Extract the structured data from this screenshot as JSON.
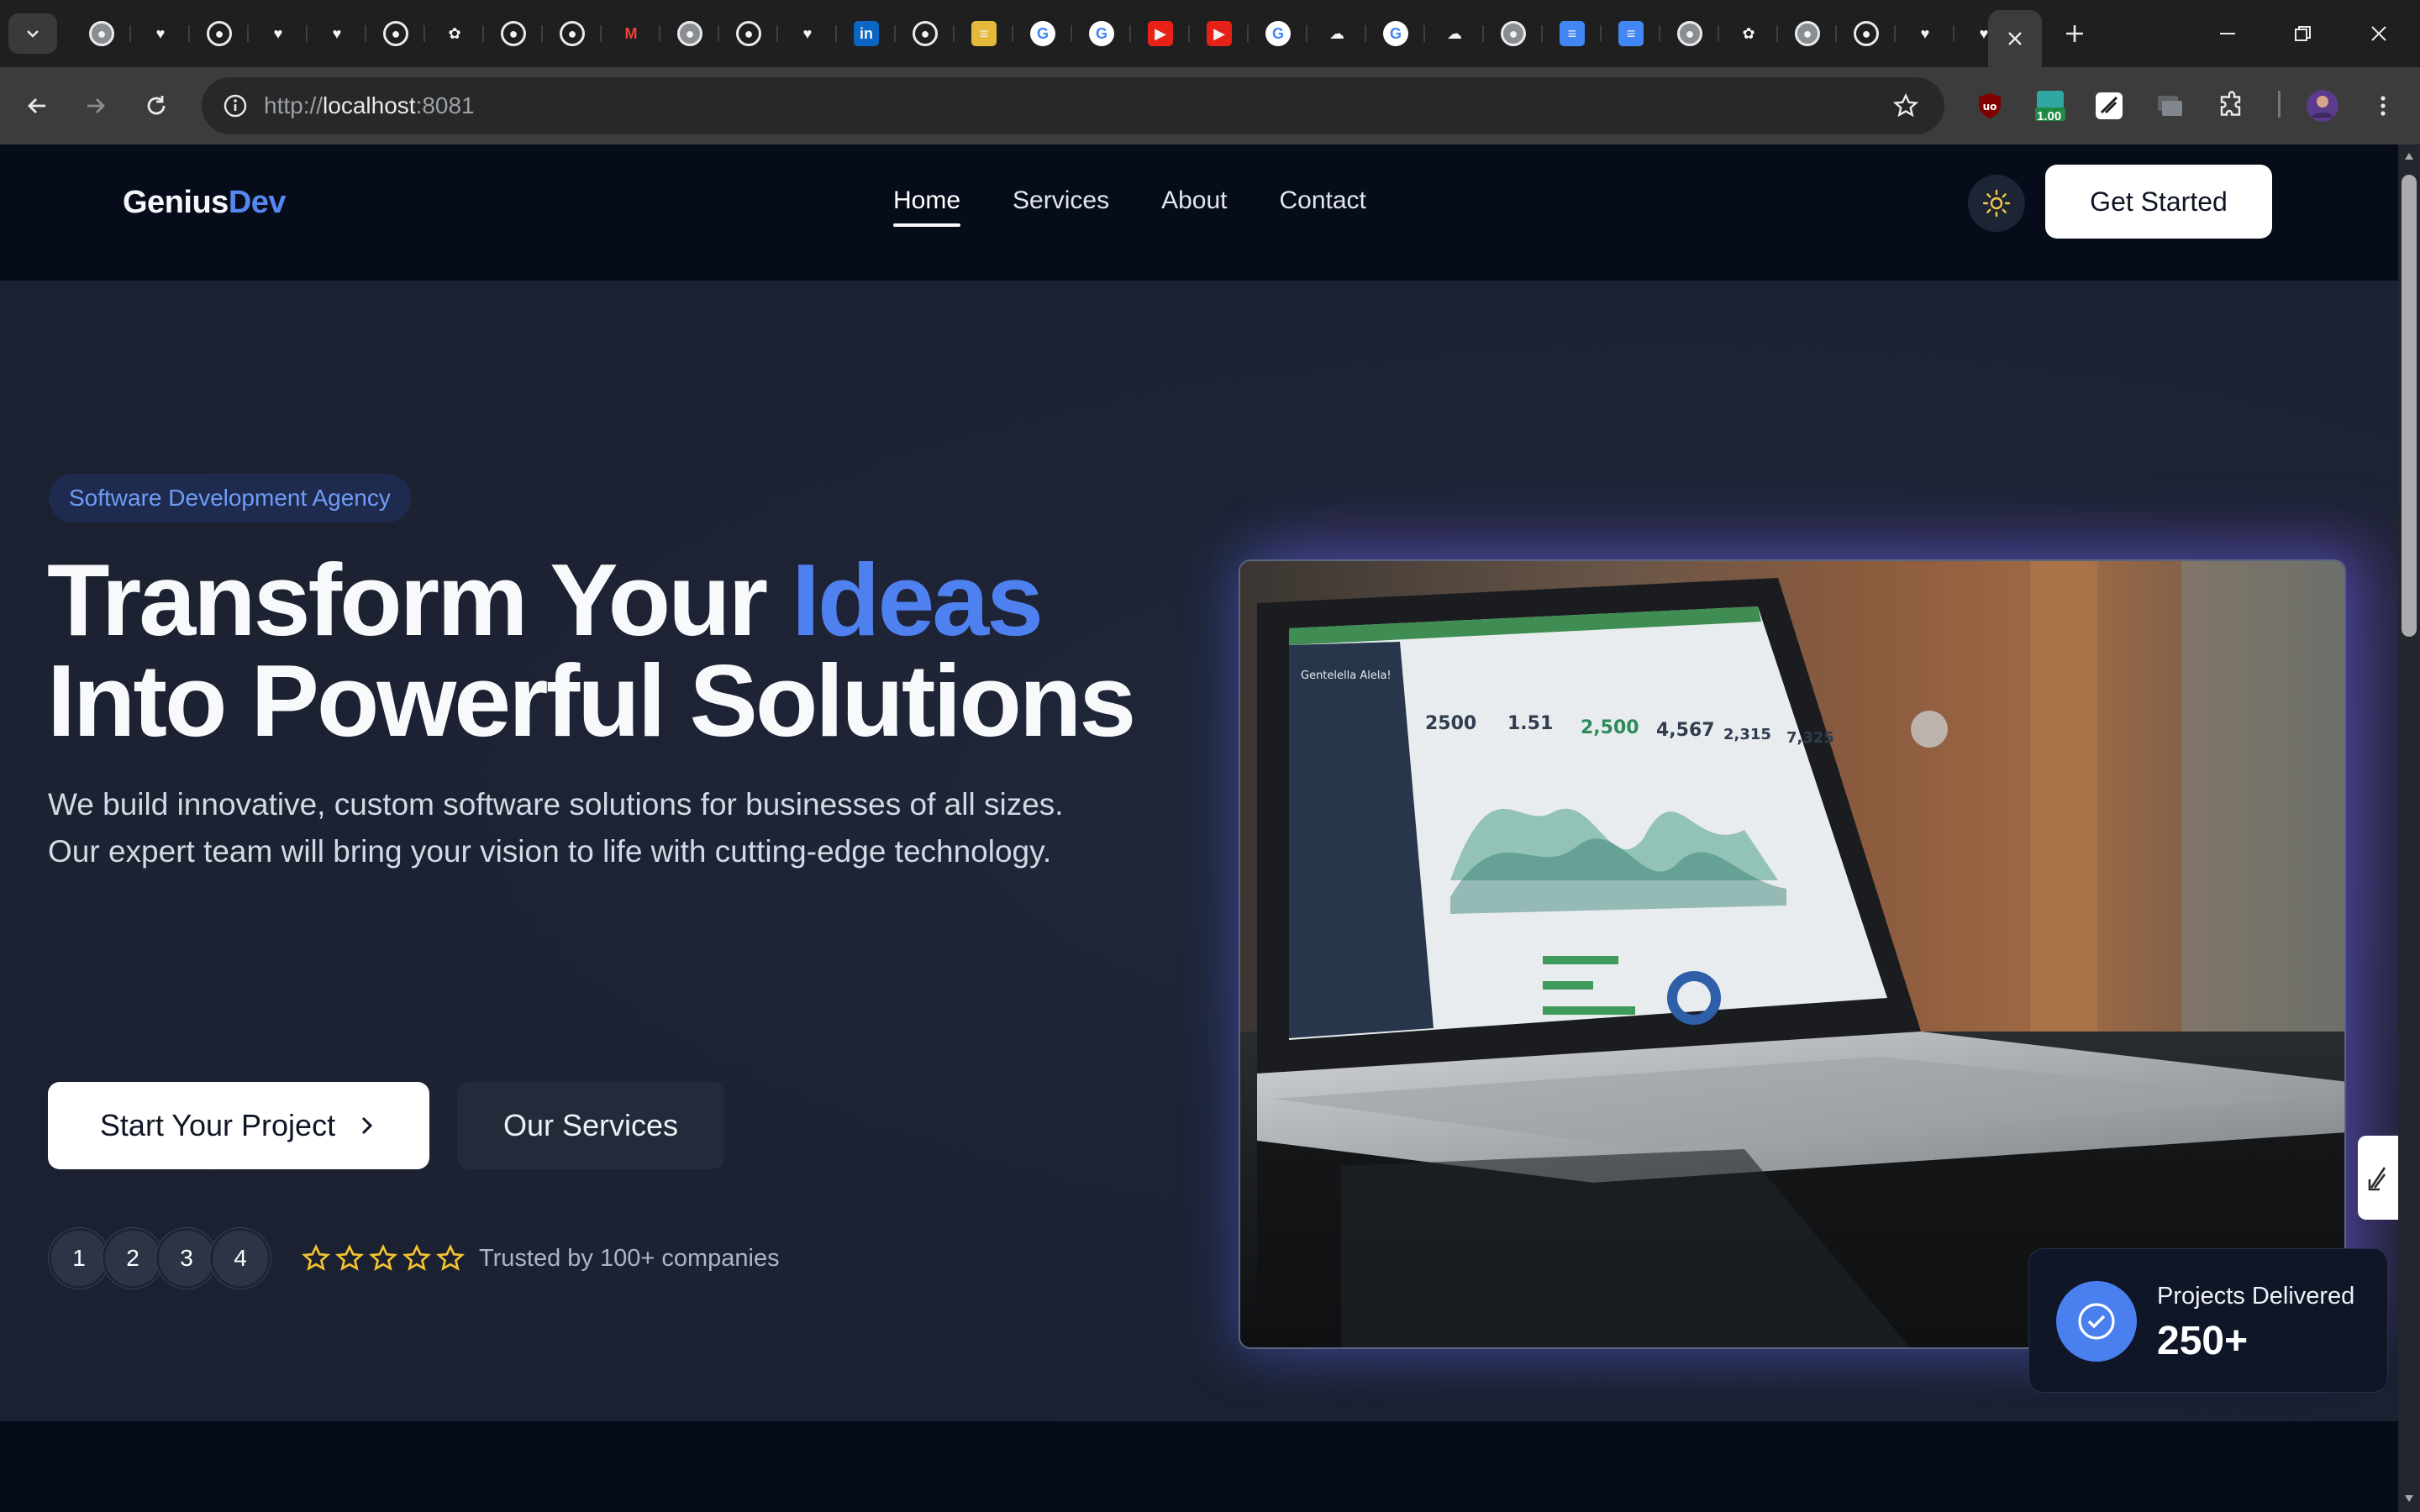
{
  "browser": {
    "pinned_tab_icons": [
      "chrome-icon",
      "heart-icon",
      "github-icon",
      "heart-icon",
      "heart-icon",
      "github-icon",
      "openai-icon",
      "github-icon",
      "github-icon",
      "gmail-icon",
      "chrome-icon",
      "github-icon",
      "heart-icon",
      "linkedin-icon",
      "github-icon",
      "stack-icon",
      "google-icon",
      "google-icon",
      "youtube-icon",
      "youtube-icon",
      "google-icon",
      "cloud-icon",
      "google-icon",
      "cloud-icon",
      "chrome-icon",
      "docs-icon",
      "docs-icon",
      "chrome-icon",
      "openai-icon",
      "chrome-icon",
      "github-icon",
      "heart-icon",
      "heart-icon"
    ],
    "url_scheme": "http://",
    "url_host": "localhost",
    "url_port": ":8081",
    "extension_badge": "1.00"
  },
  "header": {
    "logo_main": "Genius",
    "logo_accent": "Dev",
    "nav": [
      {
        "label": "Home",
        "active": true
      },
      {
        "label": "Services",
        "active": false
      },
      {
        "label": "About",
        "active": false
      },
      {
        "label": "Contact",
        "active": false
      }
    ],
    "cta_label": "Get Started"
  },
  "hero": {
    "badge": "Software Development Agency",
    "headline_part1": "Transform Your ",
    "headline_highlight": "Ideas",
    "headline_part2": "Into Powerful Solutions",
    "description_line1": "We build innovative, custom software solutions for businesses of all sizes.",
    "description_line2": "Our expert team will bring your vision to life with cutting-edge technology.",
    "primary_button": "Start Your Project",
    "secondary_button": "Our Services",
    "avatars": [
      "1",
      "2",
      "3",
      "4"
    ],
    "rating_stars": 5,
    "trusted_text": "Trusted by 100+ companies"
  },
  "stat_card": {
    "label": "Projects Delivered",
    "value": "250+"
  },
  "laptop_screen": {
    "app_name": "Gentelella Alela!",
    "metrics": [
      "2500",
      "1.51",
      "2,500",
      "4,567",
      "2,315",
      "7,325"
    ]
  },
  "colors": {
    "accent": "#4f80f0",
    "header_bg": "#060c1a",
    "hero_bg": "#1b2130"
  }
}
